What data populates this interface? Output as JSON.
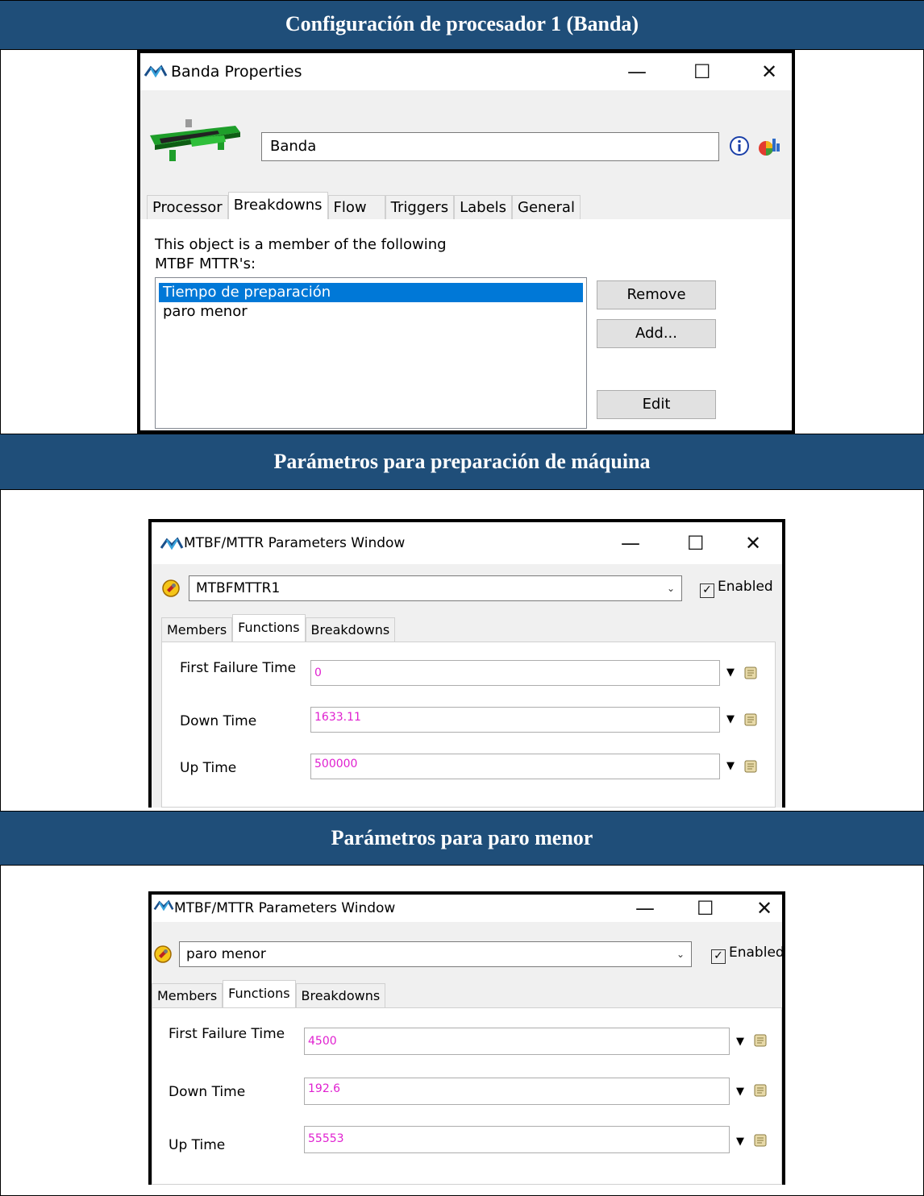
{
  "sections": [
    {
      "title": "Configuración de procesador 1 (Banda)"
    },
    {
      "title": "Parámetros para preparación de máquina"
    },
    {
      "title": "Parámetros para paro menor"
    }
  ],
  "properties_window": {
    "title": "Banda  Properties",
    "name_value": "Banda",
    "tabs": [
      "Processor",
      "Breakdowns",
      "Flow",
      "Triggers",
      "Labels",
      "General"
    ],
    "active_tab": "Breakdowns",
    "member_text_1": "This object is a member of the following",
    "member_text_2": "MTBF MTTR's:",
    "list_items": [
      "Tiempo de preparación",
      "paro menor"
    ],
    "selected_item": "Tiempo de preparación",
    "buttons": {
      "remove": "Remove",
      "add": "Add...",
      "edit": "Edit"
    }
  },
  "mtbf_window_1": {
    "title": "MTBF/MTTR Parameters Window",
    "selector_value": "MTBFMTTR1",
    "enabled_label": "Enabled",
    "enabled_checked": true,
    "tabs": [
      "Members",
      "Functions",
      "Breakdowns"
    ],
    "active_tab": "Functions",
    "fields": [
      {
        "label": "First Failure Time",
        "value": "0"
      },
      {
        "label": "Down Time",
        "value": "1633.11"
      },
      {
        "label": "Up Time",
        "value": "500000"
      }
    ]
  },
  "mtbf_window_2": {
    "title": "MTBF/MTTR Parameters Window",
    "selector_value": "paro menor",
    "enabled_label": "Enabled",
    "enabled_checked": true,
    "tabs": [
      "Members",
      "Functions",
      "Breakdowns"
    ],
    "active_tab": "Functions",
    "fields": [
      {
        "label": "First Failure Time",
        "value": "4500"
      },
      {
        "label": "Down Time",
        "value": "192.6"
      },
      {
        "label": "Up Time",
        "value": "55553"
      }
    ]
  },
  "window_controls": {
    "minimize": "—",
    "maximize": "☐",
    "close": "✕"
  },
  "colors": {
    "band": "#1f4e79",
    "selection": "#0078d7",
    "field_value": "#e020d0"
  }
}
